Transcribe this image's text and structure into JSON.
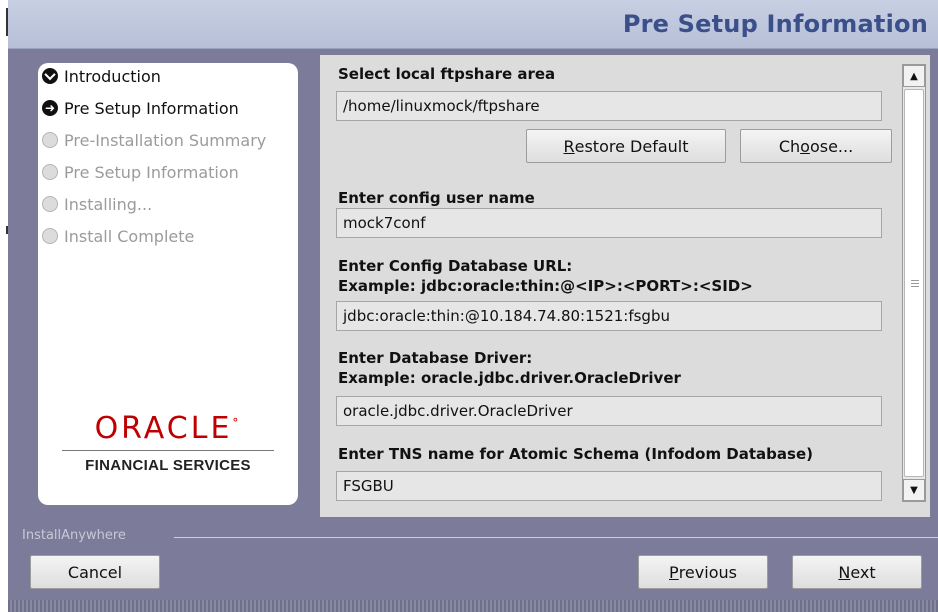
{
  "header": {
    "title": "Pre Setup Information"
  },
  "steps": [
    {
      "label": "Introduction",
      "state": "done"
    },
    {
      "label": "Pre Setup Information",
      "state": "current"
    },
    {
      "label": "Pre-Installation Summary",
      "state": "pending"
    },
    {
      "label": "Pre Setup Information",
      "state": "pending"
    },
    {
      "label": "Installing...",
      "state": "pending"
    },
    {
      "label": "Install Complete",
      "state": "pending"
    }
  ],
  "logo": {
    "word": "ORACLE",
    "tm": "°",
    "subtitle": "FINANCIAL SERVICES"
  },
  "form": {
    "ftpshare_label": "Select local ftpshare area",
    "ftpshare_value": "/home/linuxmock/ftpshare",
    "restore_default_prefix": "",
    "restore_default_u": "R",
    "restore_default_rest": "estore Default",
    "choose_prefix": "Ch",
    "choose_u": "o",
    "choose_rest": "ose...",
    "config_user_label": "Enter config user name",
    "config_user_value": "mock7conf",
    "config_url_label": "Enter Config Database URL:",
    "config_url_example": "Example: jdbc:oracle:thin:@<IP>:<PORT>:<SID>",
    "config_url_value": "jdbc:oracle:thin:@10.184.74.80:1521:fsgbu",
    "driver_label": "Enter Database Driver:",
    "driver_example": "Example: oracle.jdbc.driver.OracleDriver",
    "driver_value": "oracle.jdbc.driver.OracleDriver",
    "tns_label": "Enter TNS name for Atomic Schema (Infodom Database)",
    "tns_value": "FSGBU"
  },
  "footer": {
    "brand": "InstallAnywhere",
    "cancel": "Cancel",
    "previous_u": "P",
    "previous_rest": "revious",
    "next_u": "N",
    "next_rest": "ext"
  },
  "scrollbar": {
    "position": 0.0
  }
}
